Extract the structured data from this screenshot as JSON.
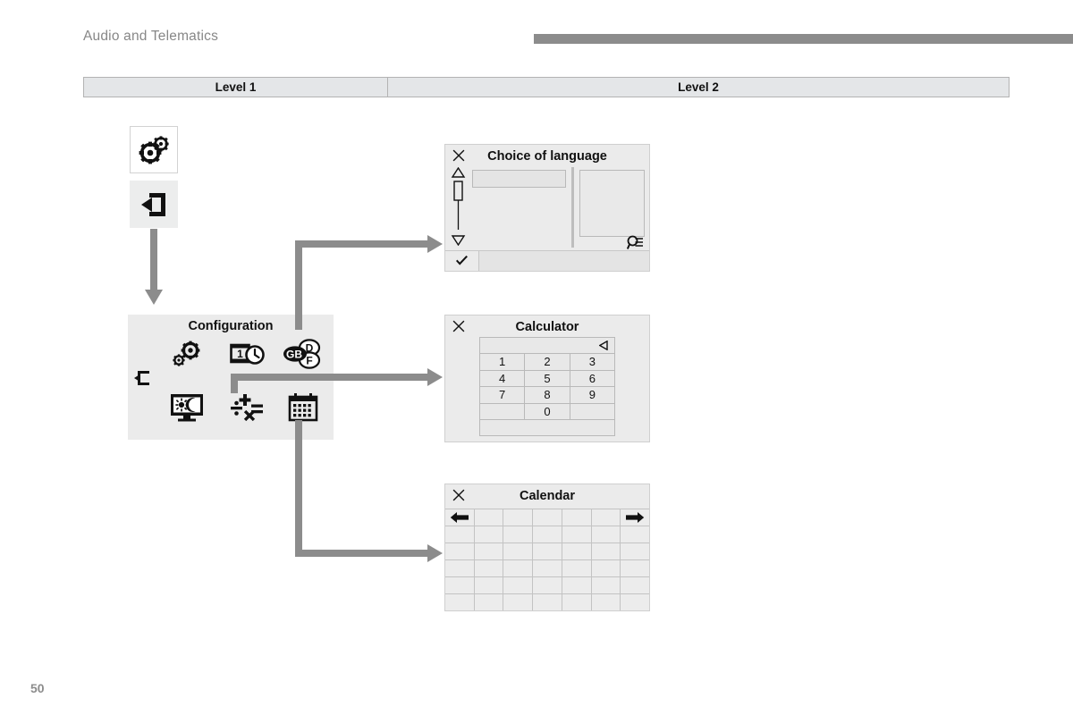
{
  "document": {
    "title": "Audio and Telematics",
    "page_number": "50",
    "header_bar_color": "#8c8c8c"
  },
  "level_header": {
    "columns": [
      {
        "label": "Level 1"
      },
      {
        "label": "Level 2"
      }
    ]
  },
  "level1_buttons": [
    {
      "name": "settings-gear-button",
      "icon": "gears-icon",
      "state": "unselected"
    },
    {
      "name": "exit-button",
      "icon": "exit-arrow-icon",
      "state": "selected"
    }
  ],
  "configuration_panel": {
    "title": "Configuration",
    "back_icon": "back-arrow-icon",
    "items": [
      {
        "icon": "gears-icon",
        "name": "general-settings"
      },
      {
        "icon": "date-time-icon",
        "name": "date-and-time"
      },
      {
        "icon": "language-icon",
        "name": "choice-of-language",
        "labels": [
          "GB",
          "D",
          "F"
        ]
      },
      {
        "icon": "display-brightness-icon",
        "name": "display-day-night"
      },
      {
        "icon": "calculator-icon",
        "name": "calculator",
        "symbols": [
          "+",
          "÷",
          "×",
          "="
        ]
      },
      {
        "icon": "calendar-icon",
        "name": "calendar"
      }
    ]
  },
  "screens": {
    "language": {
      "title": "Choice of language",
      "close_icon": "close-icon",
      "scroll_up_icon": "triangle-up-icon",
      "scroll_down_icon": "triangle-down-icon",
      "search_icon": "magnifier-icon",
      "confirm_icon": "checkmark-icon",
      "list_value": "",
      "preview_value": ""
    },
    "calculator": {
      "title": "Calculator",
      "close_icon": "close-icon",
      "backspace_icon": "backspace-arrow-icon",
      "display_value": "",
      "keys": [
        [
          "1",
          "2",
          "3"
        ],
        [
          "4",
          "5",
          "6"
        ],
        [
          "7",
          "8",
          "9"
        ],
        [
          "",
          "0",
          ""
        ]
      ],
      "result_value": ""
    },
    "calendar": {
      "title": "Calendar",
      "close_icon": "close-icon",
      "prev_icon": "arrow-left-icon",
      "next_icon": "arrow-right-icon",
      "columns": 7,
      "rows": 6
    }
  },
  "connectors": [
    {
      "name": "exit-to-configuration",
      "from": "exit-button",
      "to": "configuration-panel",
      "direction": "down"
    },
    {
      "name": "language-to-language-screen",
      "from": "language-icon",
      "to": "language-screen",
      "direction": "right"
    },
    {
      "name": "calculator-to-calculator-screen",
      "from": "calculator-icon",
      "to": "calculator-screen",
      "direction": "right"
    },
    {
      "name": "calendar-to-calendar-screen",
      "from": "calendar-icon",
      "to": "calendar-screen",
      "direction": "right"
    }
  ]
}
